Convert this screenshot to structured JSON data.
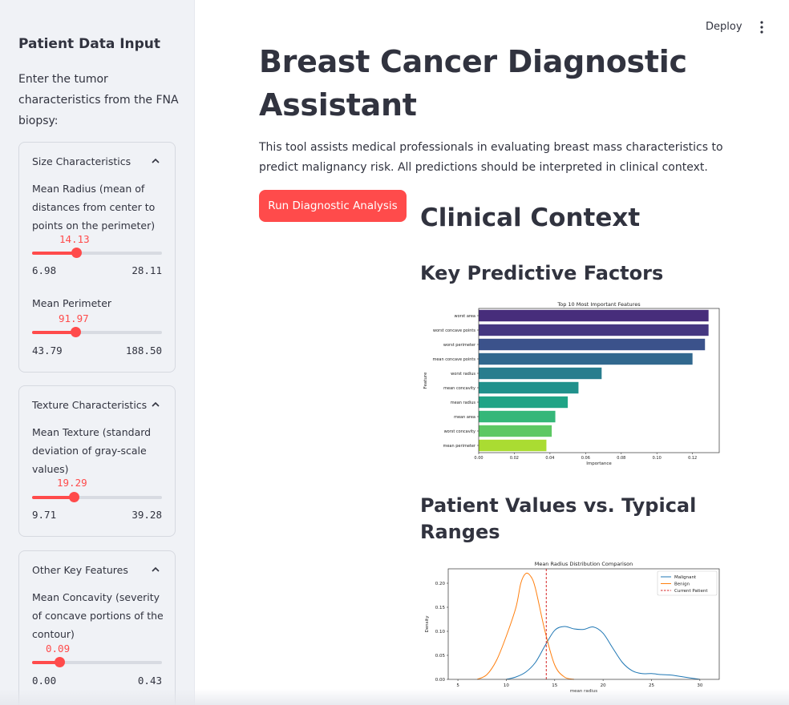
{
  "sidebar": {
    "title": "Patient Data Input",
    "intro": "Enter the tumor characteristics from the FNA biopsy:",
    "sections": [
      {
        "title": "Size Characteristics",
        "sliders": [
          {
            "label": "Mean Radius (mean of distances from center to points on the perimeter)",
            "value": "14.13",
            "min": "6.98",
            "max": "28.11",
            "fraction": 0.34
          },
          {
            "label": "Mean Perimeter",
            "value": "91.97",
            "min": "43.79",
            "max": "188.50",
            "fraction": 0.333
          }
        ]
      },
      {
        "title": "Texture Characteristics",
        "sliders": [
          {
            "label": "Mean Texture (standard deviation of gray-scale values)",
            "value": "19.29",
            "min": "9.71",
            "max": "39.28",
            "fraction": 0.324
          }
        ]
      },
      {
        "title": "Other Key Features",
        "sliders": [
          {
            "label": "Mean Concavity (severity of concave portions of the contour)",
            "value": "0.09",
            "min": "0.00",
            "max": "0.43",
            "fraction": 0.209
          }
        ]
      }
    ]
  },
  "header": {
    "deploy_label": "Deploy"
  },
  "main": {
    "title": "Breast Cancer Diagnostic Assistant",
    "description": "This tool assists medical professionals in evaluating breast mass characteristics to predict malignancy risk. All predictions should be interpreted in clinical context.",
    "run_button": "Run Diagnostic Analysis",
    "clinical_context": "Clinical Context",
    "key_factors": "Key Predictive Factors",
    "patient_values": "Patient Values vs. Typical Ranges"
  },
  "chart_data": [
    {
      "type": "bar",
      "orientation": "horizontal",
      "title": "Top 10 Most Important Features",
      "xlabel": "Importance",
      "ylabel": "Feature",
      "categories": [
        "worst area",
        "worst concave points",
        "worst perimeter",
        "mean concave points",
        "worst radius",
        "mean concavity",
        "mean radius",
        "mean area",
        "worst concavity",
        "mean perimeter"
      ],
      "values": [
        0.129,
        0.129,
        0.127,
        0.12,
        0.069,
        0.056,
        0.05,
        0.043,
        0.041,
        0.038
      ],
      "xlim": [
        0,
        0.135
      ],
      "xticks": [
        "0.00",
        "0.02",
        "0.04",
        "0.06",
        "0.08",
        "0.10",
        "0.12"
      ],
      "colors": [
        "#472d7b",
        "#453781",
        "#3b528b",
        "#31688e",
        "#287d8e",
        "#21918c",
        "#20a486",
        "#35b779",
        "#5dc863",
        "#aadc32"
      ]
    },
    {
      "type": "line",
      "title": "Mean Radius Distribution Comparison",
      "xlabel": "mean radius",
      "ylabel": "Density",
      "xlim": [
        4,
        32
      ],
      "ylim": [
        0,
        0.23
      ],
      "xticks": [
        "5",
        "10",
        "15",
        "20",
        "25",
        "30"
      ],
      "yticks": [
        "0.00",
        "0.05",
        "0.10",
        "0.15",
        "0.20"
      ],
      "series": [
        {
          "name": "Malignant",
          "color": "#1f77b4",
          "x": [
            10,
            11,
            12,
            13,
            14,
            15,
            16,
            17,
            18,
            19,
            20,
            21,
            22,
            23,
            24,
            25,
            26,
            27,
            28,
            29,
            30
          ],
          "y": [
            0.0,
            0.005,
            0.015,
            0.035,
            0.07,
            0.102,
            0.11,
            0.105,
            0.104,
            0.109,
            0.096,
            0.065,
            0.035,
            0.018,
            0.012,
            0.012,
            0.01,
            0.009,
            0.006,
            0.003,
            0.0
          ]
        },
        {
          "name": "Benign",
          "color": "#ff7f0e",
          "x": [
            7,
            8,
            9,
            10,
            11,
            11.5,
            12,
            12.5,
            13,
            14,
            15,
            16,
            17
          ],
          "y": [
            0.0,
            0.01,
            0.04,
            0.09,
            0.15,
            0.2,
            0.22,
            0.215,
            0.19,
            0.1,
            0.03,
            0.005,
            0.0
          ]
        },
        {
          "name": "Current Patient",
          "color": "#d62728",
          "style": "dashed",
          "x": [
            14.13,
            14.13
          ],
          "y": [
            0,
            0.23
          ]
        }
      ]
    }
  ]
}
